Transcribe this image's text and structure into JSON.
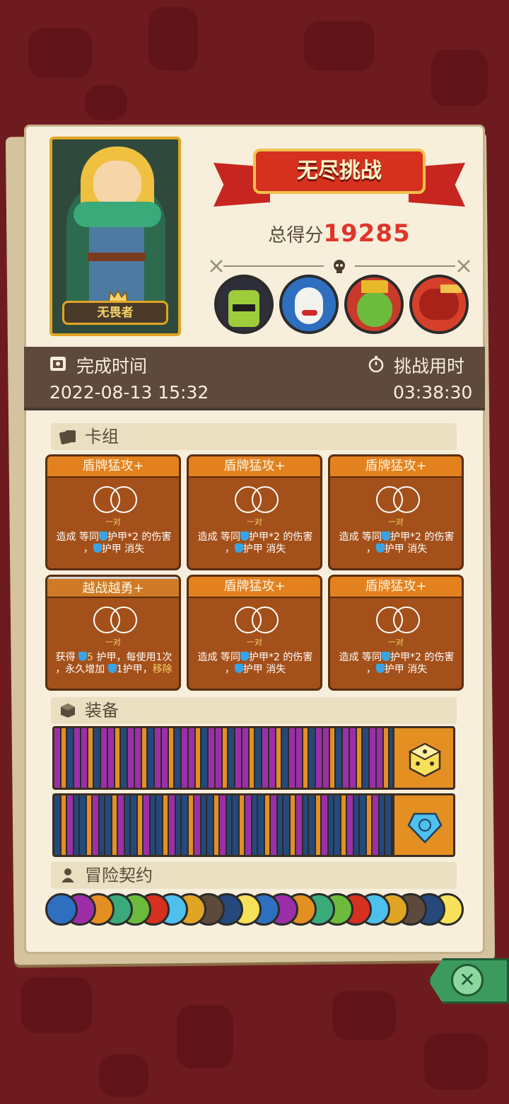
{
  "header": {
    "mode_title": "无尽挑战",
    "score_label": "总得分",
    "score_value": "19285"
  },
  "hero": {
    "rank_label": "无畏者"
  },
  "bosses": [
    {
      "icon": "green-helmet-boss-icon"
    },
    {
      "icon": "blue-mask-boss-icon"
    },
    {
      "icon": "green-demon-boss-icon"
    },
    {
      "icon": "red-dragon-boss-icon"
    }
  ],
  "timing": {
    "finish_label": "完成时间",
    "finish_value": "2022-08-13 15:32",
    "duration_label": "挑战用时",
    "duration_value": "03:38:30"
  },
  "deck": {
    "title": "卡组",
    "cards": [
      {
        "title": "盾牌猛攻+",
        "sub": "一对",
        "desc_before": "造成 等同",
        "desc_after": "护甲*2 的伤害\n，",
        "desc_tail": "护甲 消失"
      },
      {
        "title": "盾牌猛攻+",
        "sub": "一对",
        "desc_before": "造成 等同",
        "desc_after": "护甲*2 的伤害\n，",
        "desc_tail": "护甲 消失"
      },
      {
        "title": "盾牌猛攻+",
        "sub": "一对",
        "desc_before": "造成 等同",
        "desc_after": "护甲*2 的伤害\n，",
        "desc_tail": "护甲 消失"
      },
      {
        "title": "越战越勇+",
        "sub": "一对",
        "desc_before": "获得 ",
        "desc_hl": "5",
        "desc_after": " 护甲，每使用1次\n，永久增加 ",
        "desc_tail": "1护甲，",
        "desc_hl2": "移除"
      },
      {
        "title": "盾牌猛攻+",
        "sub": "一对",
        "desc_before": "造成 等同",
        "desc_after": "护甲*2 的伤害\n，",
        "desc_tail": "护甲 消失"
      },
      {
        "title": "盾牌猛攻+",
        "sub": "一对",
        "desc_before": "造成 等同",
        "desc_after": "护甲*2 的伤害\n，",
        "desc_tail": "护甲 消失"
      }
    ]
  },
  "equipment": {
    "title": "装备",
    "items": [
      {
        "icon": "yellow-dice-icon"
      },
      {
        "icon": "blue-gem-icon"
      }
    ]
  },
  "contracts": {
    "title": "冒险契约",
    "count": 22
  },
  "colors": {
    "background": "#6e1b1f",
    "panel": "#f7efdc",
    "score": "#e0352a",
    "card": "#a4501a",
    "card_header": "#e3811f",
    "armor": "#38a4e6"
  }
}
